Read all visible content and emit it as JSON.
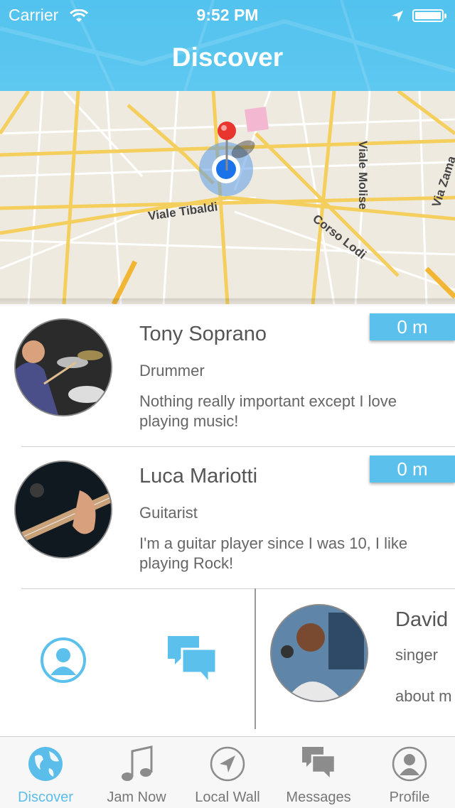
{
  "status_bar": {
    "carrier": "Carrier",
    "time": "9:52 PM"
  },
  "header": {
    "title": "Discover"
  },
  "map": {
    "streets": [
      "Viale Tibaldi",
      "Corso Lodi",
      "Viale Molise",
      "Via Zama"
    ]
  },
  "musicians": [
    {
      "name": "Tony Soprano",
      "role": "Drummer",
      "description": "Nothing really important except I love playing music!",
      "distance": "0 m"
    },
    {
      "name": "Luca Mariotti",
      "role": "Guitarist",
      "description": "I'm a guitar player since I was 10, I like playing Rock!",
      "distance": "0 m"
    }
  ],
  "swipe_card": {
    "name": "David",
    "role": "singer",
    "description": "about m"
  },
  "tabs": [
    {
      "label": "Discover",
      "icon": "globe-icon",
      "active": true
    },
    {
      "label": "Jam Now",
      "icon": "music-note-icon"
    },
    {
      "label": "Local Wall",
      "icon": "location-arrow-icon"
    },
    {
      "label": "Messages",
      "icon": "chat-bubbles-icon"
    },
    {
      "label": "Profile",
      "icon": "person-icon"
    }
  ],
  "colors": {
    "accent": "#5bc0ec",
    "header": "#55c3ef",
    "pin": "#e8352d",
    "location": "#1a73e8"
  }
}
